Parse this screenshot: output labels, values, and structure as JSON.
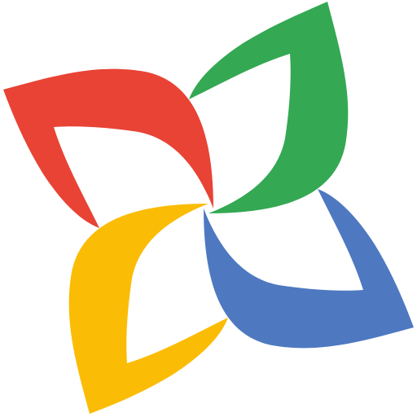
{
  "logo": {
    "icon": "four-petal-pinwheel-logo",
    "petals": [
      {
        "name": "red",
        "color": "#E84335"
      },
      {
        "name": "green",
        "color": "#34A853"
      },
      {
        "name": "yellow",
        "color": "#FBBC05"
      },
      {
        "name": "blue",
        "color": "#4E79C1"
      }
    ],
    "background": "#FFFFFF"
  }
}
